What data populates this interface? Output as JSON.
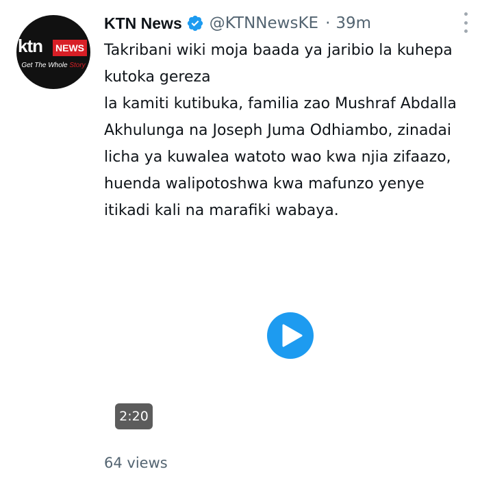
{
  "tweet": {
    "author_name": "KTN News",
    "handle": "@KTNNewsKE",
    "separator": "·",
    "time": "39m",
    "avatar": {
      "brand": "ktn",
      "badge": "NEWS",
      "tagline_white": "Get The Whole ",
      "tagline_red": "Story"
    },
    "text_lines": [
      "Takribani wiki moja baada ya jaribio la kuhepa",
      "kutoka gereza",
      "la kamiti kutibuka, familia zao Mushraf Abdalla",
      "Akhulunga na Joseph Juma Odhiambo, zinadai",
      "licha ya kuwalea watoto wao kwa njia zifaazo,",
      "huenda walipotoshwa kwa mafunzo yenye",
      "itikadi kali na marafiki wabaya."
    ],
    "video": {
      "duration": "2:20"
    },
    "views": "64 views"
  },
  "icons": {
    "verified": "verified-badge-icon",
    "more": "more-options-icon",
    "play": "play-icon"
  },
  "colors": {
    "accent": "#1d9bf0",
    "brand_red": "#d81f26",
    "muted_text": "#536471"
  }
}
